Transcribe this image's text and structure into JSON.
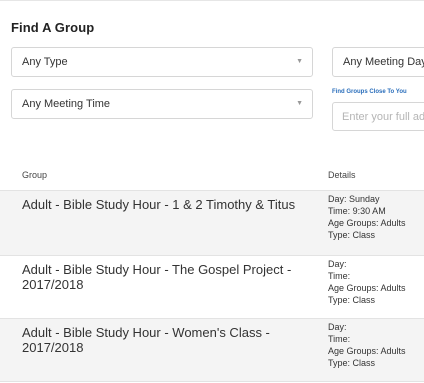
{
  "page": {
    "title": "Find A Group"
  },
  "filters": {
    "type": "Any Type",
    "meeting_day": "Any Meeting Day",
    "meeting_time": "Any Meeting Time",
    "near_label": "Find Groups Close To You",
    "address_placeholder": "Enter your full address"
  },
  "table": {
    "headers": {
      "group": "Group",
      "details": "Details"
    },
    "rows": [
      {
        "name": "Adult - Bible Study Hour - 1 & 2 Timothy & Titus",
        "day": "Day: Sunday",
        "time": "Time: 9:30 AM",
        "age": "Age Groups: Adults",
        "type": "Type: Class"
      },
      {
        "name": "Adult - Bible Study Hour - The Gospel Project - 2017/2018",
        "day": "Day:",
        "time": "Time:",
        "age": "Age Groups: Adults",
        "type": "Type: Class"
      },
      {
        "name": "Adult - Bible Study Hour - Women's Class - 2017/2018",
        "day": "Day:",
        "time": "Time:",
        "age": "Age Groups: Adults",
        "type": "Type: Class"
      }
    ]
  }
}
